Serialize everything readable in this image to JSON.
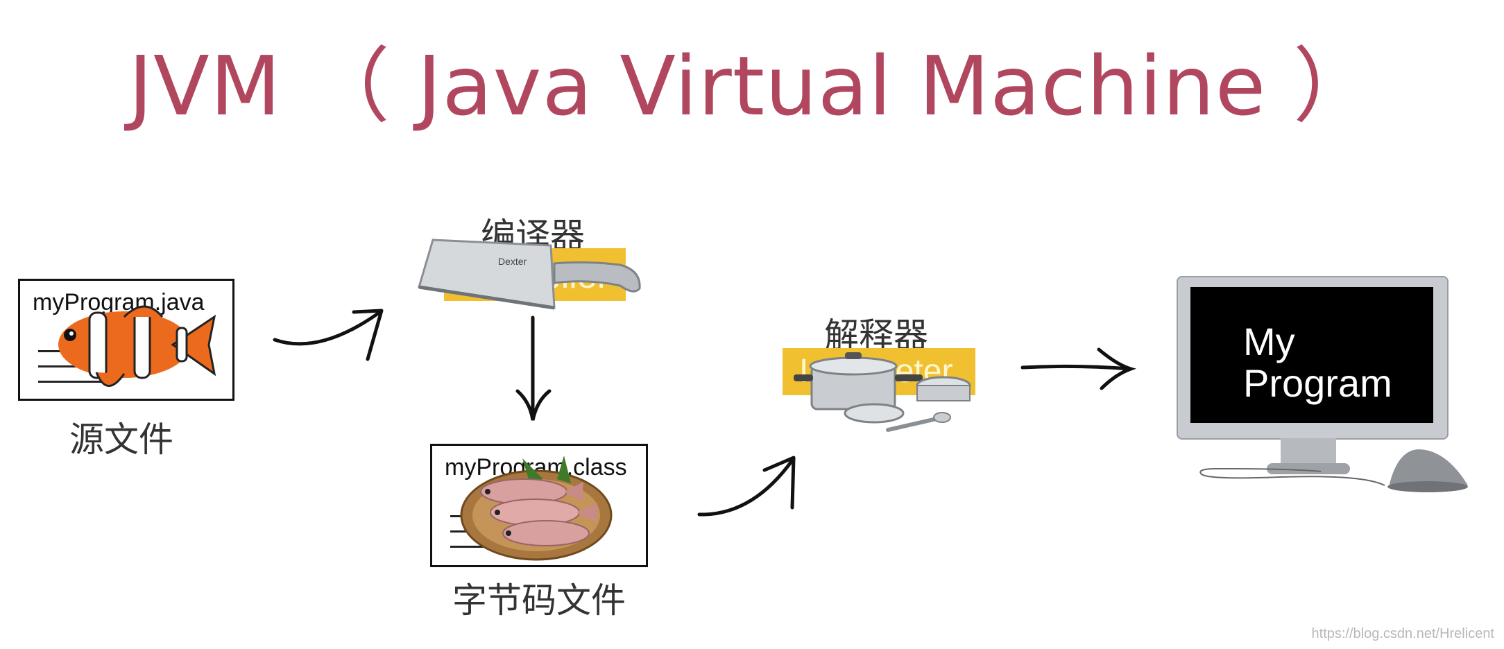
{
  "title": "JVM （ Java Virtual Machine ）",
  "source": {
    "filename": "myProgram.java",
    "caption": "源文件"
  },
  "compiler": {
    "caption": "编译器",
    "banner_text": "Compiler"
  },
  "bytecode": {
    "filename": "myProgram.class",
    "caption": "字节码文件"
  },
  "interpreter": {
    "caption": "解释器",
    "banner_text": "Interpreter"
  },
  "output": {
    "line1": "My",
    "line2": "Program"
  },
  "knife_brand": "Dexter",
  "watermark": "https://blog.csdn.net/Hrelicent",
  "colors": {
    "title": "#b0475f",
    "banner": "#f0c030",
    "arrow": "#111111"
  }
}
